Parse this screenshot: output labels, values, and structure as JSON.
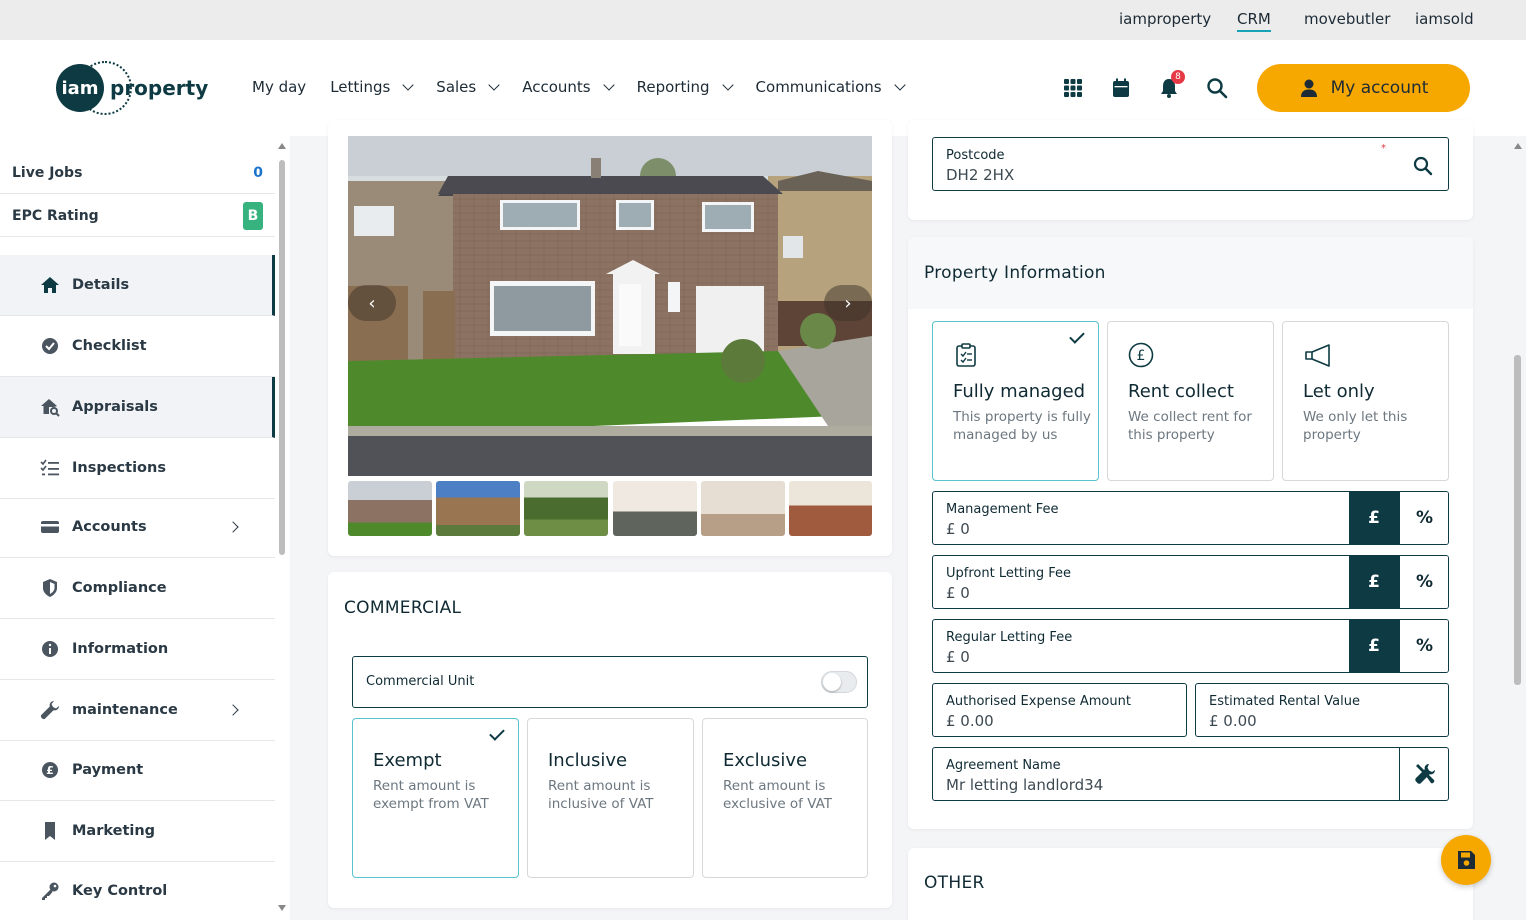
{
  "topbar": {
    "links": [
      "iamproperty",
      "CRM",
      "movebutler",
      "iamsold"
    ],
    "active": "CRM"
  },
  "header": {
    "logo_mark": "iam",
    "logo_word": "property",
    "nav": [
      "My day",
      "Lettings",
      "Sales",
      "Accounts",
      "Reporting",
      "Communications"
    ],
    "notifications_count": "8",
    "account_label": "My account",
    "icons": [
      "apps-grid-icon",
      "calendar-icon",
      "bell-icon",
      "search-icon",
      "user-icon"
    ]
  },
  "sidebar": {
    "stats": [
      {
        "label": "Live Jobs",
        "value": "0"
      },
      {
        "label": "EPC Rating",
        "value": "B"
      }
    ],
    "items": [
      {
        "label": "Details",
        "icon": "home-icon"
      },
      {
        "label": "Checklist",
        "icon": "check-circle-icon"
      },
      {
        "label": "Appraisals",
        "icon": "house-search-icon"
      },
      {
        "label": "Inspections",
        "icon": "list-check-icon"
      },
      {
        "label": "Accounts",
        "icon": "card-icon"
      },
      {
        "label": "Compliance",
        "icon": "shield-icon"
      },
      {
        "label": "Information",
        "icon": "info-icon"
      },
      {
        "label": "maintenance",
        "icon": "wrench-icon"
      },
      {
        "label": "Payment",
        "icon": "pound-circle-icon"
      },
      {
        "label": "Marketing",
        "icon": "bookmark-icon"
      },
      {
        "label": "Key Control",
        "icon": "key-icon"
      }
    ]
  },
  "photos": {
    "prev": "‹",
    "next": "›",
    "thumb_count": 6
  },
  "commercial": {
    "title": "COMMERCIAL",
    "unit_label": "Commercial Unit",
    "unit_on": false,
    "options": [
      {
        "title": "Exempt",
        "desc": "Rent amount is exempt from VAT",
        "selected": true
      },
      {
        "title": "Inclusive",
        "desc": "Rent amount is inclusive of VAT",
        "selected": false
      },
      {
        "title": "Exclusive",
        "desc": "Rent amount is exclusive of VAT",
        "selected": false
      }
    ]
  },
  "postcode": {
    "label": "Postcode",
    "value": "DH2 2HX",
    "required_mark": "*"
  },
  "property_info": {
    "title": "Property Information",
    "options": [
      {
        "title": "Fully managed",
        "desc": "This property is fully managed by us",
        "icon": "clipboard-icon",
        "selected": true
      },
      {
        "title": "Rent collect",
        "desc": "We collect rent for this property",
        "icon": "pound-circle-icon",
        "selected": false
      },
      {
        "title": "Let only",
        "desc": "We only let this property",
        "icon": "megaphone-icon",
        "selected": false
      }
    ],
    "management_fee": {
      "label": "Management Fee",
      "value": "£ 0"
    },
    "upfront_fee": {
      "label": "Upfront Letting Fee",
      "value": "£ 0"
    },
    "regular_fee": {
      "label": "Regular Letting Fee",
      "value": "£ 0"
    },
    "pound_symbol": "£",
    "percent_symbol": "%",
    "authorised_expense": {
      "label": "Authorised Expense Amount",
      "value": "£ 0.00"
    },
    "estimated_rent": {
      "label": "Estimated Rental Value",
      "value": "£ 0.00"
    },
    "agreement": {
      "label": "Agreement Name",
      "value": "Mr letting landlord34"
    }
  },
  "other": {
    "title": "OTHER"
  },
  "colors": {
    "brand_dark": "#0e3b43",
    "accent": "#f6a800",
    "selected_border": "#58c3cf",
    "epc_green": "#36b37e",
    "badge_red": "#e53945"
  }
}
